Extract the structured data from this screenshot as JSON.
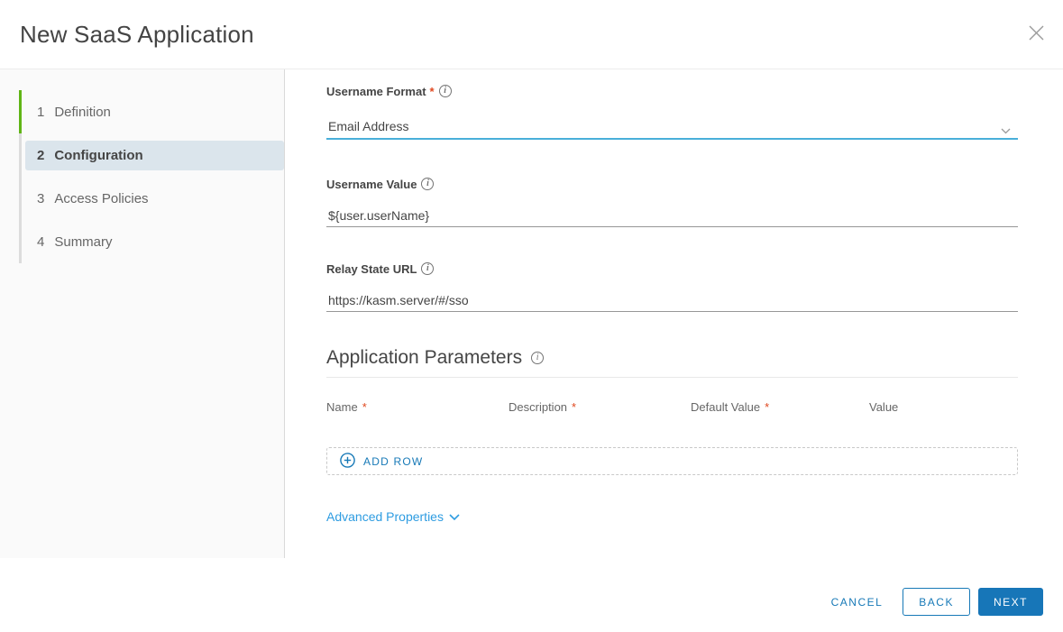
{
  "dialog": {
    "title": "New SaaS Application"
  },
  "steps": [
    {
      "number": "1",
      "label": "Definition",
      "state": "complete"
    },
    {
      "number": "2",
      "label": "Configuration",
      "state": "current"
    },
    {
      "number": "3",
      "label": "Access Policies",
      "state": "upcoming"
    },
    {
      "number": "4",
      "label": "Summary",
      "state": "upcoming"
    }
  ],
  "form": {
    "username_format": {
      "label": "Username Format",
      "required": "*",
      "value": "Email Address"
    },
    "username_value": {
      "label": "Username Value",
      "value": "${user.userName}"
    },
    "relay_state_url": {
      "label": "Relay State URL",
      "value": "https://kasm.server/#/sso"
    },
    "application_parameters": {
      "heading": "Application Parameters",
      "columns": [
        {
          "label": "Name",
          "required": "*"
        },
        {
          "label": "Description",
          "required": "*"
        },
        {
          "label": "Default Value",
          "required": "*"
        },
        {
          "label": "Value",
          "required": ""
        }
      ],
      "add_row_label": "ADD ROW"
    },
    "advanced_properties_label": "Advanced Properties"
  },
  "footer": {
    "cancel_label": "CANCEL",
    "back_label": "BACK",
    "next_label": "NEXT"
  },
  "icons": {
    "info_glyph": "i"
  },
  "colors": {
    "action_blue": "#1776b8",
    "select_underline_blue": "#49afd9",
    "link_blue": "#2e9ce1",
    "step_complete_green": "#60b515",
    "current_step_highlight": "#dbe5ec",
    "required_red": "#e0481f",
    "sidebar_bg": "#fafafa"
  }
}
